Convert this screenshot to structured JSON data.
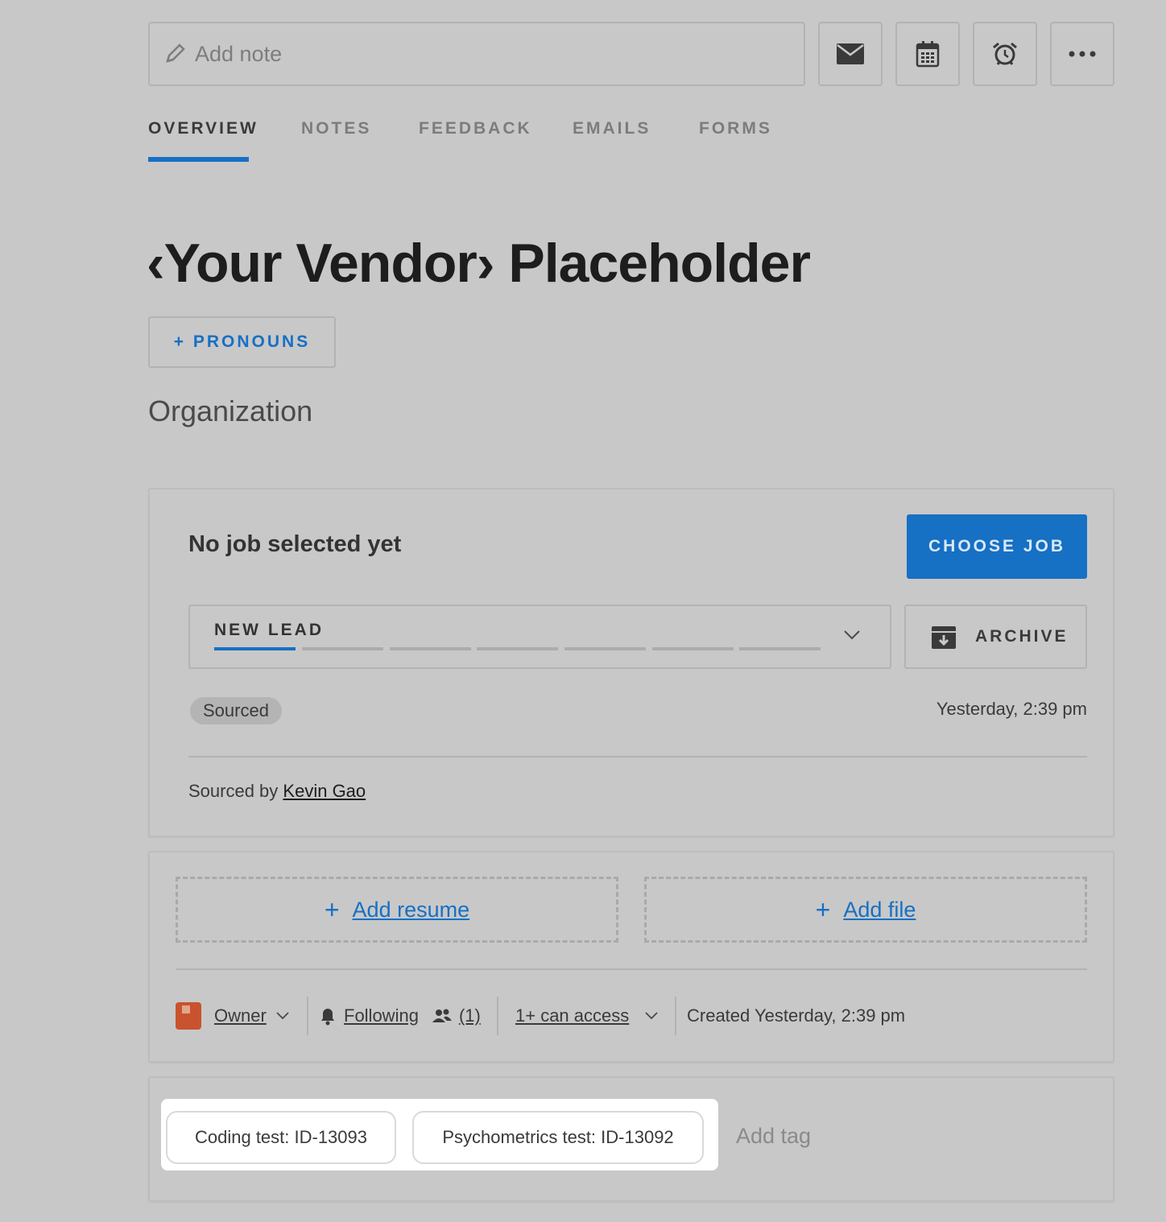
{
  "toolbar": {
    "note_placeholder": "Add note",
    "icons": [
      "email-icon",
      "calendar-icon",
      "alarm-icon",
      "more-icon"
    ]
  },
  "tabs": [
    {
      "label": "OVERVIEW",
      "active": true
    },
    {
      "label": "NOTES",
      "active": false
    },
    {
      "label": "FEEDBACK",
      "active": false
    },
    {
      "label": "EMAILS",
      "active": false
    },
    {
      "label": "FORMS",
      "active": false
    }
  ],
  "profile": {
    "name": "‹Your Vendor› Placeholder",
    "pronouns_button": "+ PRONOUNS",
    "organization": "Organization"
  },
  "job_card": {
    "title": "No job selected yet",
    "choose_button": "CHOOSE JOB",
    "stage": "NEW LEAD",
    "archive_button": "ARCHIVE",
    "badge": "Sourced",
    "timestamp": "Yesterday, 2:39 pm",
    "sourced_by_label": "Sourced by",
    "sourced_by_name": "Kevin Gao"
  },
  "files_card": {
    "add_resume": "Add resume",
    "add_file": "Add file",
    "owner": "Owner",
    "following": "Following",
    "followers_count": "(1)",
    "access": "1+ can access",
    "created": "Created Yesterday, 2:39 pm"
  },
  "tags": {
    "items": [
      "Coding test: ID-13093",
      "Psychometrics test: ID-13092"
    ],
    "add_placeholder": "Add tag"
  },
  "colors": {
    "accent": "#1670c4",
    "background": "#c8c8c8",
    "title": "#1d1d1d"
  }
}
